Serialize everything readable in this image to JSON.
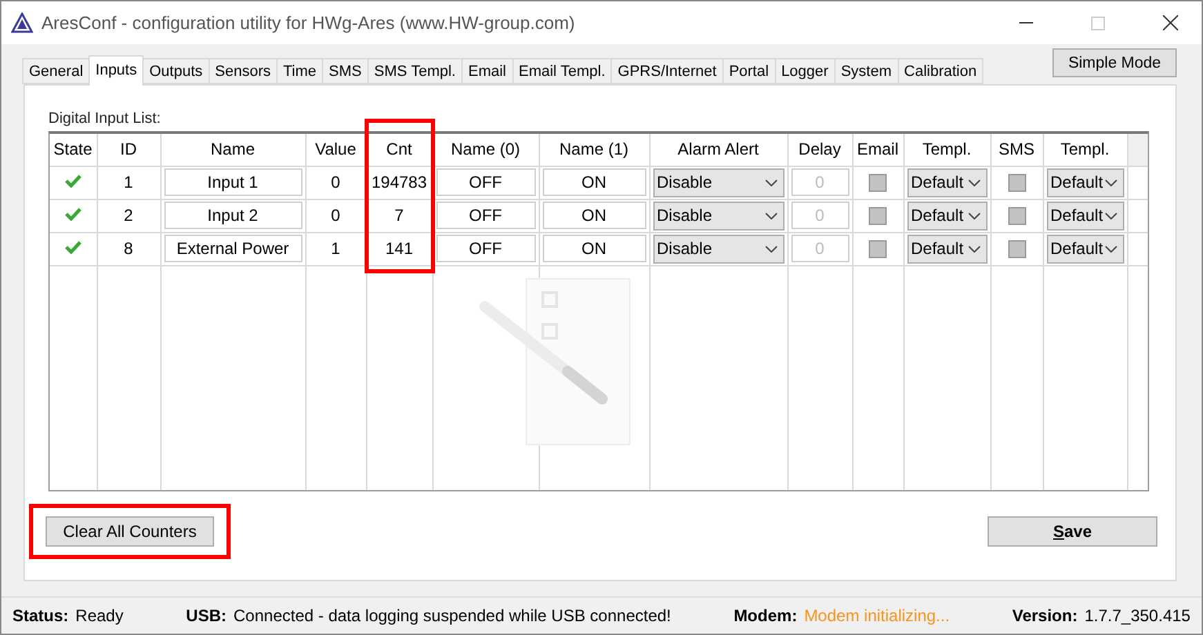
{
  "window": {
    "title": "AresConf - configuration utility for HWg-Ares (www.HW-group.com)"
  },
  "tabs": [
    {
      "label": "General",
      "selected": false
    },
    {
      "label": "Inputs",
      "selected": true
    },
    {
      "label": "Outputs",
      "selected": false
    },
    {
      "label": "Sensors",
      "selected": false
    },
    {
      "label": "Time",
      "selected": false
    },
    {
      "label": "SMS",
      "selected": false
    },
    {
      "label": "SMS Templ.",
      "selected": false
    },
    {
      "label": "Email",
      "selected": false
    },
    {
      "label": "Email Templ.",
      "selected": false
    },
    {
      "label": "GPRS/Internet",
      "selected": false
    },
    {
      "label": "Portal",
      "selected": false
    },
    {
      "label": "Logger",
      "selected": false
    },
    {
      "label": "System",
      "selected": false
    },
    {
      "label": "Calibration",
      "selected": false
    }
  ],
  "mode_button": "Simple Mode",
  "list_label": "Digital Input List:",
  "table": {
    "columns": [
      {
        "label": "State",
        "highlighted": false
      },
      {
        "label": "ID",
        "highlighted": false
      },
      {
        "label": "Name",
        "highlighted": false
      },
      {
        "label": "Value",
        "highlighted": false
      },
      {
        "label": "Cnt",
        "highlighted": true
      },
      {
        "label": "Name (0)",
        "highlighted": false
      },
      {
        "label": "Name (1)",
        "highlighted": false
      },
      {
        "label": "Alarm Alert",
        "highlighted": false
      },
      {
        "label": "Delay",
        "highlighted": false
      },
      {
        "label": "Email",
        "highlighted": false
      },
      {
        "label": "Templ.",
        "highlighted": false
      },
      {
        "label": "SMS",
        "highlighted": false
      },
      {
        "label": "Templ.",
        "highlighted": false
      }
    ],
    "rows": [
      {
        "ok": true,
        "id": "1",
        "name": "Input 1",
        "value": "0",
        "cnt": "194783",
        "name0": "OFF",
        "name1": "ON",
        "alarm": "Disable",
        "delay": "0",
        "delay_disabled": true,
        "email": false,
        "email_templ": "Default",
        "sms": false,
        "sms_templ": "Default"
      },
      {
        "ok": true,
        "id": "2",
        "name": "Input 2",
        "value": "0",
        "cnt": "7",
        "name0": "OFF",
        "name1": "ON",
        "alarm": "Disable",
        "delay": "0",
        "delay_disabled": true,
        "email": false,
        "email_templ": "Default",
        "sms": false,
        "sms_templ": "Default"
      },
      {
        "ok": true,
        "id": "8",
        "name": "External Power",
        "value": "1",
        "cnt": "141",
        "name0": "OFF",
        "name1": "ON",
        "alarm": "Disable",
        "delay": "0",
        "delay_disabled": true,
        "email": false,
        "email_templ": "Default",
        "sms": false,
        "sms_templ": "Default"
      }
    ]
  },
  "clear_button": {
    "label": "Clear All Counters",
    "highlighted": true
  },
  "save_button": "Save",
  "status_bar": [
    {
      "label": "Status:",
      "value": "Ready",
      "kind": "normal"
    },
    {
      "label": "USB:",
      "value": "Connected - data logging suspended while USB connected!",
      "kind": "normal"
    },
    {
      "label": "Modem:",
      "value": "Modem initializing...",
      "kind": "warning"
    },
    {
      "label": "Version:",
      "value": "1.7.7_350.415",
      "kind": "normal"
    }
  ]
}
